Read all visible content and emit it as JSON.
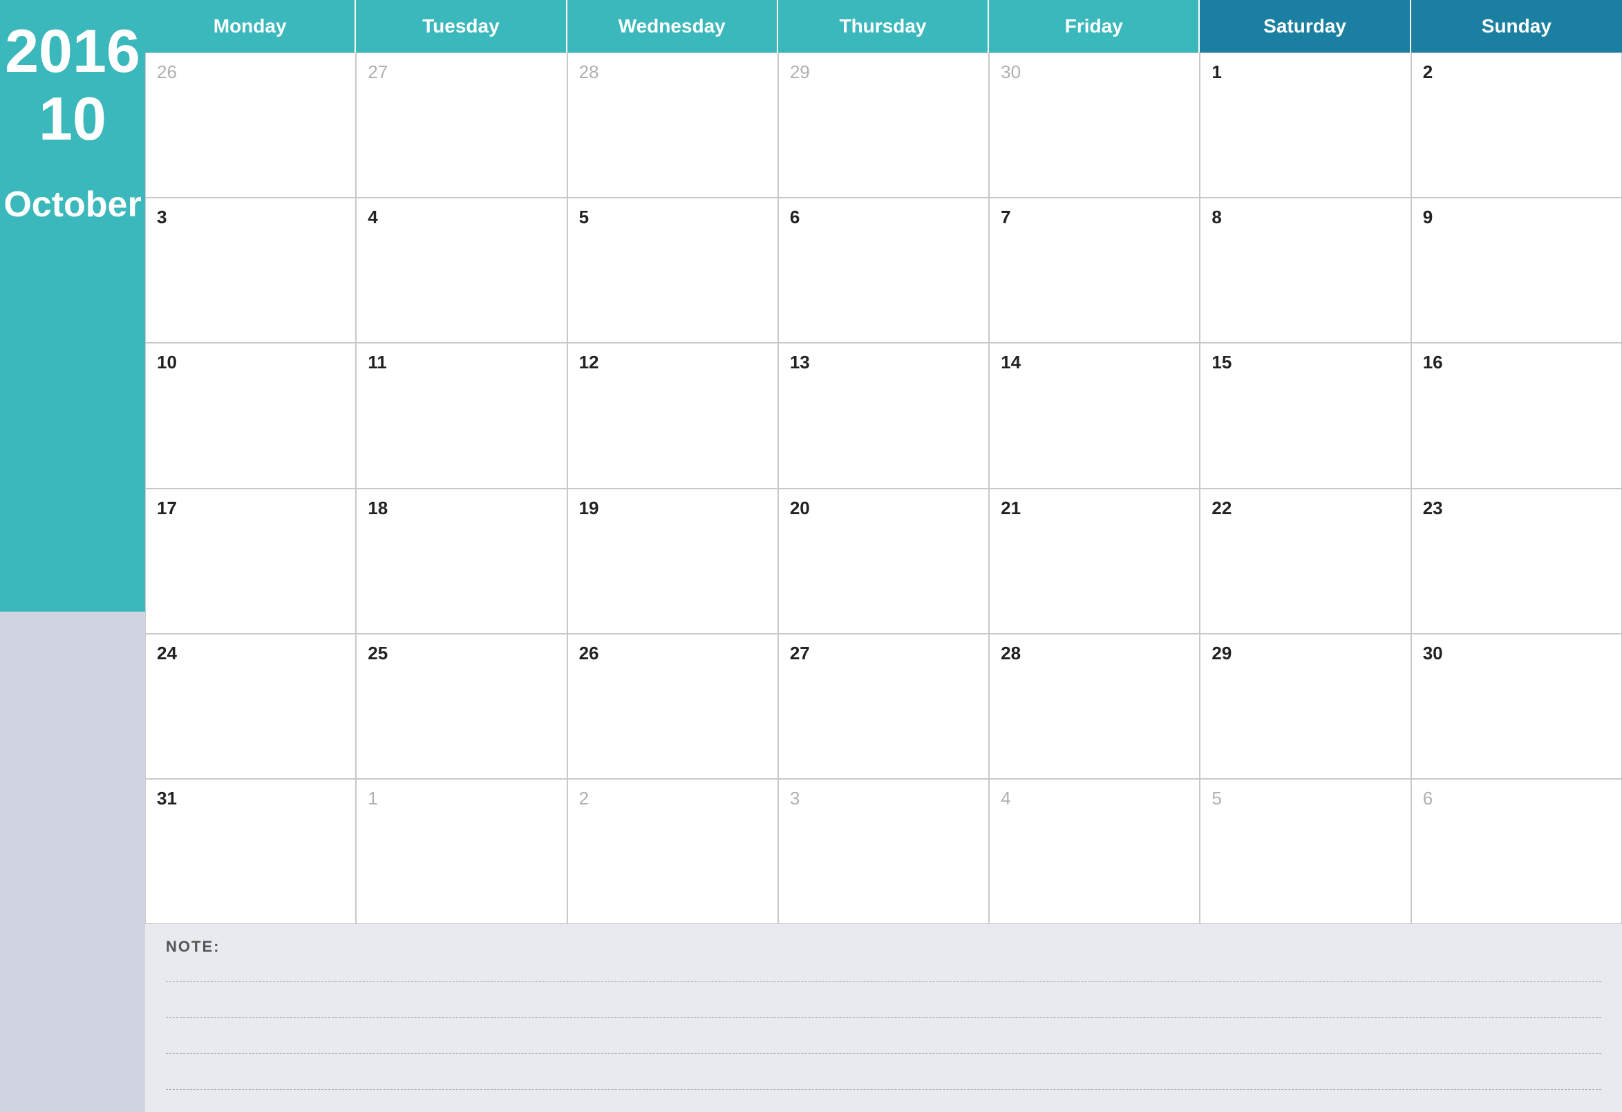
{
  "sidebar": {
    "year": "2016",
    "month_number": "10",
    "month_name": "October"
  },
  "header": {
    "days": [
      "Monday",
      "Tuesday",
      "Wednesday",
      "Thursday",
      "Friday",
      "Saturday",
      "Sunday"
    ]
  },
  "calendar": {
    "weeks": [
      [
        {
          "num": "26",
          "faded": true
        },
        {
          "num": "27",
          "faded": true
        },
        {
          "num": "28",
          "faded": true
        },
        {
          "num": "29",
          "faded": true
        },
        {
          "num": "30",
          "faded": true
        },
        {
          "num": "1",
          "faded": false
        },
        {
          "num": "2",
          "faded": false
        }
      ],
      [
        {
          "num": "3",
          "faded": false
        },
        {
          "num": "4",
          "faded": false
        },
        {
          "num": "5",
          "faded": false
        },
        {
          "num": "6",
          "faded": false
        },
        {
          "num": "7",
          "faded": false
        },
        {
          "num": "8",
          "faded": false
        },
        {
          "num": "9",
          "faded": false
        }
      ],
      [
        {
          "num": "10",
          "faded": false
        },
        {
          "num": "11",
          "faded": false
        },
        {
          "num": "12",
          "faded": false
        },
        {
          "num": "13",
          "faded": false
        },
        {
          "num": "14",
          "faded": false
        },
        {
          "num": "15",
          "faded": false
        },
        {
          "num": "16",
          "faded": false
        }
      ],
      [
        {
          "num": "17",
          "faded": false
        },
        {
          "num": "18",
          "faded": false
        },
        {
          "num": "19",
          "faded": false
        },
        {
          "num": "20",
          "faded": false
        },
        {
          "num": "21",
          "faded": false
        },
        {
          "num": "22",
          "faded": false
        },
        {
          "num": "23",
          "faded": false
        }
      ],
      [
        {
          "num": "24",
          "faded": false
        },
        {
          "num": "25",
          "faded": false
        },
        {
          "num": "26",
          "faded": false
        },
        {
          "num": "27",
          "faded": false
        },
        {
          "num": "28",
          "faded": false
        },
        {
          "num": "29",
          "faded": false
        },
        {
          "num": "30",
          "faded": false
        }
      ],
      [
        {
          "num": "31",
          "faded": false
        },
        {
          "num": "1",
          "faded": true
        },
        {
          "num": "2",
          "faded": true
        },
        {
          "num": "3",
          "faded": true
        },
        {
          "num": "4",
          "faded": true
        },
        {
          "num": "5",
          "faded": true
        },
        {
          "num": "6",
          "faded": true
        }
      ]
    ]
  },
  "notes": {
    "label": "NOTE:",
    "lines": 4
  }
}
